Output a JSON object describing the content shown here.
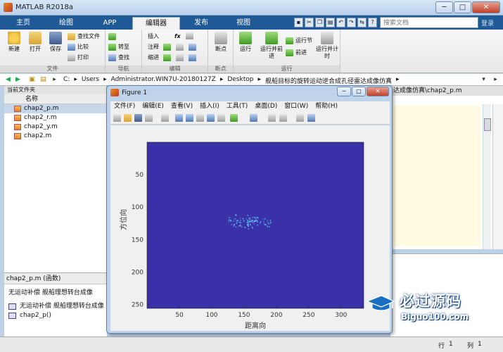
{
  "window": {
    "title": "MATLAB R2018a",
    "minimize": "─",
    "maximize": "□",
    "close": "✕"
  },
  "tabs": [
    {
      "label": "主页"
    },
    {
      "label": "绘图"
    },
    {
      "label": "APP"
    },
    {
      "label": "编辑器",
      "active": true
    },
    {
      "label": "发布"
    },
    {
      "label": "视图"
    }
  ],
  "search": {
    "placeholder": "搜索文档"
  },
  "login": "登录",
  "ribbon": {
    "file": {
      "label": "文件",
      "new": "新建",
      "open": "打开",
      "save": "保存",
      "find_files": "查找文件",
      "compare": "比较",
      "print": "打印"
    },
    "navigate": {
      "label": "导航",
      "goto": "转至",
      "find": "查找"
    },
    "edit": {
      "label": "编辑",
      "insert": "插入",
      "fx": "fx",
      "comment": "注释",
      "indent": "缩进"
    },
    "breakpoints": {
      "label": "断点",
      "breakpoint": "断点"
    },
    "run": {
      "label": "运行",
      "run": "运行",
      "run_advance": "运行并前进",
      "run_section": "运行节",
      "advance": "前进",
      "run_time": "运行并计时"
    }
  },
  "path": {
    "segments": [
      "C:",
      "Users",
      "Administrator.WIN7U-20180127Z",
      "Desktop",
      "舰船目标的旋转运动逆合成孔径雷达成像仿真"
    ]
  },
  "current_folder": {
    "title": "当前文件夹",
    "name_header": "名称",
    "files": [
      "chap2_p.m",
      "chap2_r.m",
      "chap2_y.m",
      "chap2.m"
    ]
  },
  "details": {
    "header": "chap2_p.m  (函数)",
    "description": "无运动补偿 舰船理想转台成像",
    "items": [
      "无运动补偿 舰船理想转台成像",
      "chap2_p()"
    ]
  },
  "editor": {
    "tab": "达成像仿真\\chap2_p.m"
  },
  "status": {
    "row_label": "行",
    "row": "1",
    "col_label": "列",
    "col": "1"
  },
  "figure": {
    "title": "Figure 1",
    "menu": [
      "文件(F)",
      "编辑(E)",
      "查看(V)",
      "插入(I)",
      "工具(T)",
      "桌面(D)",
      "窗口(W)",
      "帮助(H)"
    ]
  },
  "chart_data": {
    "type": "heatmap",
    "title": "",
    "xlabel": "距离向",
    "ylabel": "方位向",
    "xlim": [
      0,
      335
    ],
    "ylim": [
      256,
      0
    ],
    "xticks": [
      50,
      100,
      150,
      200,
      250,
      300
    ],
    "yticks": [
      50,
      100,
      150,
      200,
      250
    ],
    "background_color": "#3a30a8",
    "target_color": "#5fd0ff",
    "target": {
      "x_range": [
        125,
        193
      ],
      "y_range": [
        110,
        134
      ],
      "center_y": 122
    }
  },
  "watermark": {
    "cn": "必过源码",
    "en": "Biguo100.com"
  }
}
